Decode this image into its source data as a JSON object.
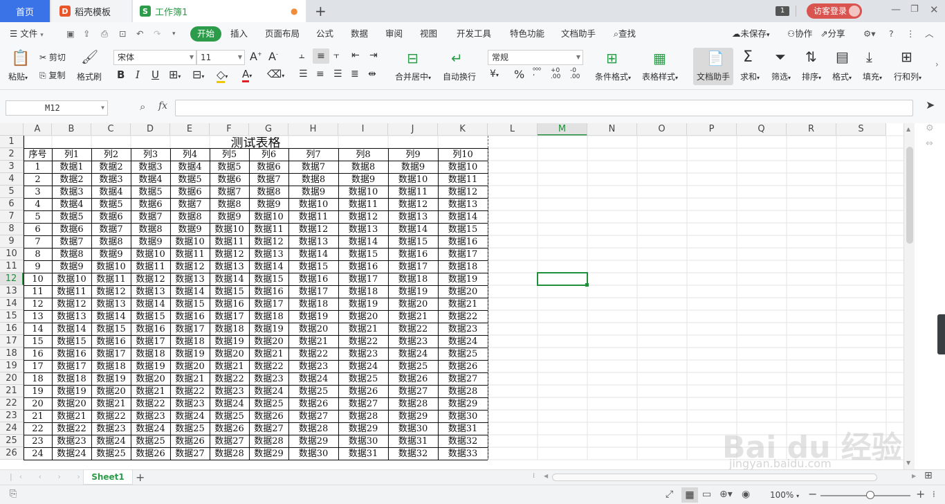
{
  "titlebar": {
    "tabs": [
      {
        "label": "首页"
      },
      {
        "label": "稻壳模板"
      },
      {
        "label": "工作簿1"
      }
    ],
    "count_badge": "1",
    "login_label": "访客登录"
  },
  "menubar": {
    "file_label": "文件",
    "items": [
      "开始",
      "插入",
      "页面布局",
      "公式",
      "数据",
      "审阅",
      "视图",
      "开发工具",
      "特色功能",
      "文档助手"
    ],
    "search_label": "查找",
    "unsaved_label": "未保存",
    "collab_label": "协作",
    "share_label": "分享"
  },
  "ribbon": {
    "paste_label": "粘贴",
    "cut_label": "剪切",
    "copy_label": "复制",
    "format_painter_label": "格式刷",
    "font_name": "宋体",
    "font_size": "11",
    "merge_label": "合并居中",
    "wrap_label": "自动换行",
    "number_format": "常规",
    "cond_format_label": "条件格式",
    "table_style_label": "表格样式",
    "doc_assistant_label": "文档助手",
    "sum_label": "求和",
    "filter_label": "筛选",
    "sort_label": "排序",
    "format_label": "格式",
    "fill_label": "填充",
    "rowcol_label": "行和列"
  },
  "formula_bar": {
    "cell_ref": "M12",
    "fx_label": "fx",
    "value": ""
  },
  "sheet": {
    "columns": [
      "A",
      "B",
      "C",
      "D",
      "E",
      "F",
      "G",
      "H",
      "I",
      "J",
      "K",
      "L",
      "M",
      "N",
      "O",
      "P",
      "Q",
      "R",
      "S"
    ],
    "rows": [
      "1",
      "2",
      "3",
      "4",
      "5",
      "6",
      "7",
      "8",
      "9",
      "10",
      "11",
      "12",
      "13",
      "14",
      "15",
      "16",
      "17",
      "18",
      "19",
      "20",
      "21",
      "22",
      "23",
      "24",
      "25",
      "26"
    ],
    "title": "测试表格",
    "headers": [
      "序号",
      "列1",
      "列2",
      "列3",
      "列4",
      "列5",
      "列6",
      "列7",
      "列8",
      "列9",
      "列10"
    ],
    "data_rows": [
      [
        "1",
        "数据1",
        "数据2",
        "数据3",
        "数据4",
        "数据5",
        "数据6",
        "数据7",
        "数据8",
        "数据9",
        "数据10"
      ],
      [
        "2",
        "数据2",
        "数据3",
        "数据4",
        "数据5",
        "数据6",
        "数据7",
        "数据8",
        "数据9",
        "数据10",
        "数据11"
      ],
      [
        "3",
        "数据3",
        "数据4",
        "数据5",
        "数据6",
        "数据7",
        "数据8",
        "数据9",
        "数据10",
        "数据11",
        "数据12"
      ],
      [
        "4",
        "数据4",
        "数据5",
        "数据6",
        "数据7",
        "数据8",
        "数据9",
        "数据10",
        "数据11",
        "数据12",
        "数据13"
      ],
      [
        "5",
        "数据5",
        "数据6",
        "数据7",
        "数据8",
        "数据9",
        "数据10",
        "数据11",
        "数据12",
        "数据13",
        "数据14"
      ],
      [
        "6",
        "数据6",
        "数据7",
        "数据8",
        "数据9",
        "数据10",
        "数据11",
        "数据12",
        "数据13",
        "数据14",
        "数据15"
      ],
      [
        "7",
        "数据7",
        "数据8",
        "数据9",
        "数据10",
        "数据11",
        "数据12",
        "数据13",
        "数据14",
        "数据15",
        "数据16"
      ],
      [
        "8",
        "数据8",
        "数据9",
        "数据10",
        "数据11",
        "数据12",
        "数据13",
        "数据14",
        "数据15",
        "数据16",
        "数据17"
      ],
      [
        "9",
        "数据9",
        "数据10",
        "数据11",
        "数据12",
        "数据13",
        "数据14",
        "数据15",
        "数据16",
        "数据17",
        "数据18"
      ],
      [
        "10",
        "数据10",
        "数据11",
        "数据12",
        "数据13",
        "数据14",
        "数据15",
        "数据16",
        "数据17",
        "数据18",
        "数据19"
      ],
      [
        "11",
        "数据11",
        "数据12",
        "数据13",
        "数据14",
        "数据15",
        "数据16",
        "数据17",
        "数据18",
        "数据19",
        "数据20"
      ],
      [
        "12",
        "数据12",
        "数据13",
        "数据14",
        "数据15",
        "数据16",
        "数据17",
        "数据18",
        "数据19",
        "数据20",
        "数据21"
      ],
      [
        "13",
        "数据13",
        "数据14",
        "数据15",
        "数据16",
        "数据17",
        "数据18",
        "数据19",
        "数据20",
        "数据21",
        "数据22"
      ],
      [
        "14",
        "数据14",
        "数据15",
        "数据16",
        "数据17",
        "数据18",
        "数据19",
        "数据20",
        "数据21",
        "数据22",
        "数据23"
      ],
      [
        "15",
        "数据15",
        "数据16",
        "数据17",
        "数据18",
        "数据19",
        "数据20",
        "数据21",
        "数据22",
        "数据23",
        "数据24"
      ],
      [
        "16",
        "数据16",
        "数据17",
        "数据18",
        "数据19",
        "数据20",
        "数据21",
        "数据22",
        "数据23",
        "数据24",
        "数据25"
      ],
      [
        "17",
        "数据17",
        "数据18",
        "数据19",
        "数据20",
        "数据21",
        "数据22",
        "数据23",
        "数据24",
        "数据25",
        "数据26"
      ],
      [
        "18",
        "数据18",
        "数据19",
        "数据20",
        "数据21",
        "数据22",
        "数据23",
        "数据24",
        "数据25",
        "数据26",
        "数据27"
      ],
      [
        "19",
        "数据19",
        "数据20",
        "数据21",
        "数据22",
        "数据23",
        "数据24",
        "数据25",
        "数据26",
        "数据27",
        "数据28"
      ],
      [
        "20",
        "数据20",
        "数据21",
        "数据22",
        "数据23",
        "数据24",
        "数据25",
        "数据26",
        "数据27",
        "数据28",
        "数据29"
      ],
      [
        "21",
        "数据21",
        "数据22",
        "数据23",
        "数据24",
        "数据25",
        "数据26",
        "数据27",
        "数据28",
        "数据29",
        "数据30"
      ],
      [
        "22",
        "数据22",
        "数据23",
        "数据24",
        "数据25",
        "数据26",
        "数据27",
        "数据28",
        "数据29",
        "数据30",
        "数据31"
      ],
      [
        "23",
        "数据23",
        "数据24",
        "数据25",
        "数据26",
        "数据27",
        "数据28",
        "数据29",
        "数据30",
        "数据31",
        "数据32"
      ],
      [
        "24",
        "数据24",
        "数据25",
        "数据26",
        "数据27",
        "数据28",
        "数据29",
        "数据30",
        "数据31",
        "数据32",
        "数据33"
      ]
    ],
    "active_cell": "M12",
    "sheet_tab": "Sheet1"
  },
  "statusbar": {
    "zoom": "100%"
  },
  "watermark": {
    "brand": "Bai du 经验",
    "url": "jingyan.baidu.com"
  },
  "colors": {
    "accent_green": "#2c9b4a",
    "home_tab_blue": "#3a73e8",
    "login_red": "#d9534f",
    "selection_green": "#1f8f3b"
  }
}
